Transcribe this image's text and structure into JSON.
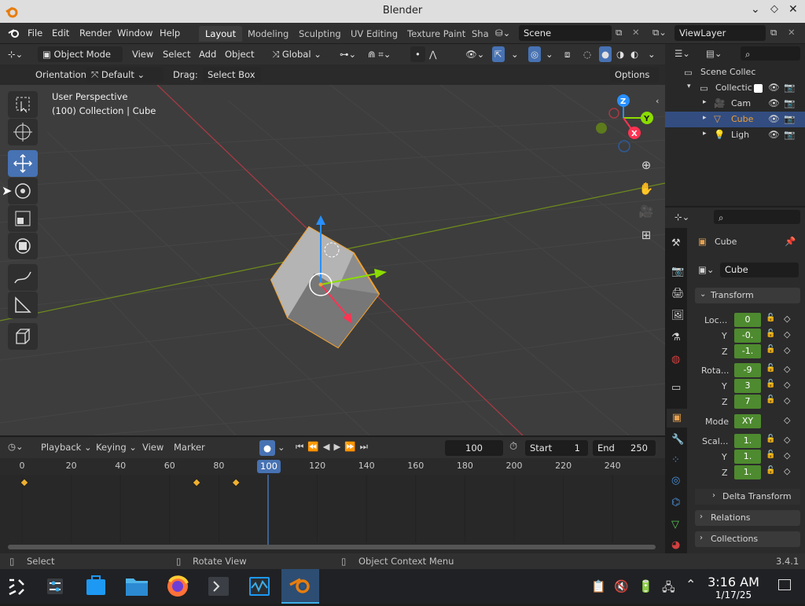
{
  "window": {
    "title": "Blender"
  },
  "menu": [
    "File",
    "Edit",
    "Render",
    "Window",
    "Help"
  ],
  "workspaces": [
    "Layout",
    "Modeling",
    "Sculpting",
    "UV Editing",
    "Texture Paint",
    "Sha"
  ],
  "scene": {
    "name": "Scene",
    "view_layer": "ViewLayer"
  },
  "viewport_header": {
    "mode": "Object Mode",
    "menus": [
      "View",
      "Select",
      "Add",
      "Object"
    ],
    "transform_orientation": "Global"
  },
  "tool_settings": {
    "orientation_label": "Orientation:",
    "orientation_value": "Default",
    "drag_label": "Drag:",
    "drag_value": "Select Box",
    "options": "Options"
  },
  "viewport": {
    "perspective": "User Perspective",
    "collection_info": "(100) Collection | Cube"
  },
  "gizmo_axes": {
    "x": "X",
    "y": "Y",
    "z": "Z"
  },
  "timeline": {
    "menus": [
      "Playback",
      "Keying",
      "View",
      "Marker"
    ],
    "current_frame": "100",
    "start_label": "Start",
    "start": "1",
    "end_label": "End",
    "end": "250",
    "ticks": [
      "0",
      "20",
      "40",
      "60",
      "80",
      "100",
      "120",
      "140",
      "160",
      "180",
      "200",
      "220",
      "240"
    ],
    "keyframes": [
      0,
      70,
      86
    ]
  },
  "outliner": {
    "items": [
      {
        "label": "Scene Collec"
      },
      {
        "label": "Collectic"
      },
      {
        "label": "Cam"
      },
      {
        "label": "Cube"
      },
      {
        "label": "Ligh"
      }
    ]
  },
  "properties": {
    "object_name": "Cube",
    "data_name": "Cube",
    "transform_label": "Transform",
    "location_label": "Loc...",
    "rotation_label": "Rota...",
    "scale_label": "Scal...",
    "y": "Y",
    "z": "Z",
    "location": [
      "0",
      "-0.",
      "-1."
    ],
    "rotation": [
      "-9",
      "3",
      "7"
    ],
    "mode_label": "Mode",
    "mode": "XY",
    "scale": [
      "1.",
      "1.",
      "1."
    ],
    "delta": "Delta Transform",
    "relations": "Relations",
    "collections": "Collections"
  },
  "status": {
    "select": "Select",
    "rotate": "Rotate View",
    "context": "Object Context Menu",
    "version": "3.4.1"
  },
  "clock": {
    "time": "3:16 AM",
    "date": "1/17/25"
  },
  "colors": {
    "accent": "#4772b3",
    "outline": "#f0a030",
    "xaxis": "#ff3352",
    "yaxis": "#8bdc00",
    "zaxis": "#2890ff"
  }
}
